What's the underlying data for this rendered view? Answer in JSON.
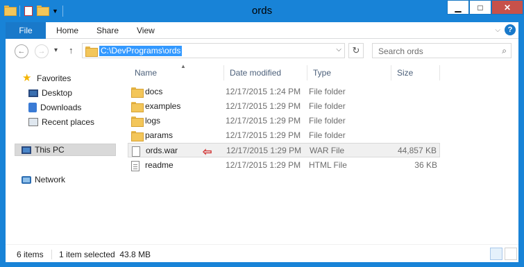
{
  "window": {
    "title": "ords"
  },
  "titlebar": {
    "min_label": "▁",
    "max_label": "□",
    "close_label": "✕"
  },
  "ribbon": {
    "tabs": [
      {
        "label": "File"
      },
      {
        "label": "Home"
      },
      {
        "label": "Share"
      },
      {
        "label": "View"
      }
    ],
    "help_label": "?",
    "collapse_label": "⌵"
  },
  "navbar": {
    "back_label": "←",
    "forward_label": "→",
    "recent_label": "▾",
    "up_label": "↑",
    "address": "C:\\DevPrograms\\ords",
    "address_dropdown": "⌵",
    "refresh_label": "↻",
    "search_placeholder": "Search ords",
    "search_icon": "⌕"
  },
  "navpane": {
    "items": [
      {
        "label": "Favorites",
        "icon": "star-icon"
      },
      {
        "label": "Desktop",
        "icon": "desktop-icon"
      },
      {
        "label": "Downloads",
        "icon": "downloads-icon"
      },
      {
        "label": "Recent places",
        "icon": "recent-places-icon"
      },
      {
        "label": "This PC",
        "icon": "this-pc-icon"
      },
      {
        "label": "Network",
        "icon": "network-icon"
      }
    ]
  },
  "filelist": {
    "columns": {
      "name": "Name",
      "date": "Date modified",
      "type": "Type",
      "size": "Size"
    },
    "sort_arrow": "▲",
    "rows": [
      {
        "name": "docs",
        "date": "12/17/2015 1:24 PM",
        "type": "File folder",
        "size": "",
        "icon": "folder-icon"
      },
      {
        "name": "examples",
        "date": "12/17/2015 1:29 PM",
        "type": "File folder",
        "size": "",
        "icon": "folder-icon"
      },
      {
        "name": "logs",
        "date": "12/17/2015 1:29 PM",
        "type": "File folder",
        "size": "",
        "icon": "folder-icon"
      },
      {
        "name": "params",
        "date": "12/17/2015 1:29 PM",
        "type": "File folder",
        "size": "",
        "icon": "folder-icon"
      },
      {
        "name": "ords.war",
        "date": "12/17/2015 1:29 PM",
        "type": "WAR File",
        "size": "44,857 KB",
        "icon": "file-icon"
      },
      {
        "name": "readme",
        "date": "12/17/2015 1:29 PM",
        "type": "HTML File",
        "size": "36 KB",
        "icon": "html-file-icon"
      }
    ],
    "marker": "⇦"
  },
  "status": {
    "count": "6 items",
    "selection": "1 item selected  43.8 MB"
  },
  "colors": {
    "accent": "#1883d7",
    "selection": "#3399ff",
    "marker": "#d23a3a"
  }
}
